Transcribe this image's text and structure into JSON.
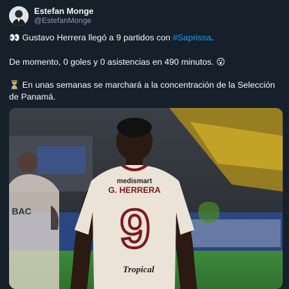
{
  "author": {
    "display_name": "Estefan Monge",
    "handle": "@EstefanMonge",
    "avatar_icon": "user-avatar-icon"
  },
  "tweet": {
    "line1_emoji": "👀",
    "line1_text": " Gustavo Herrera llegó a 9 partidos con ",
    "hashtag": "#Saprissa",
    "line1_end": ".",
    "line2_text": "De momento, 0 goles y 0 asistencias en 490 minutos. ",
    "line2_emoji": "😮",
    "line3_emoji": "⏳",
    "line3_text": "  En unas semanas se marchará a la concentración de la Selección de Panamá."
  },
  "media": {
    "jersey_sponsor": "medismart",
    "jersey_name": "G. HERRERA",
    "jersey_number": "9",
    "jersey_bottom": "Tropical",
    "background_jersey_text": "BAC"
  },
  "colors": {
    "background": "#15202b",
    "text": "#f7f9f9",
    "secondary": "#8b98a5",
    "accent": "#1d9bf0"
  }
}
